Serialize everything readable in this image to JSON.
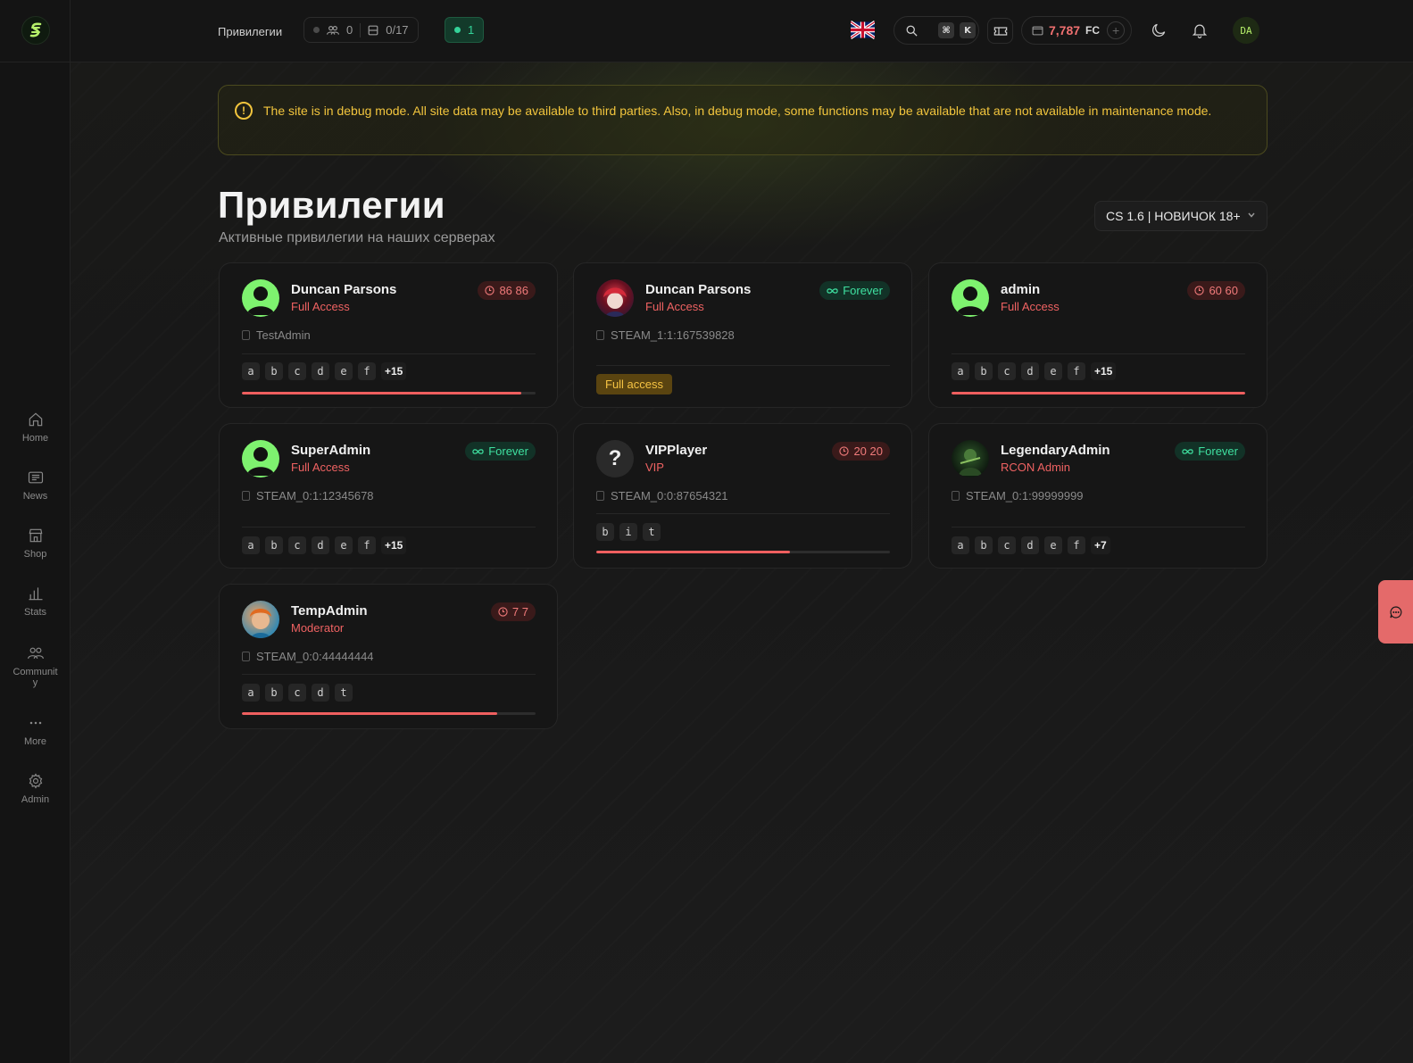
{
  "sidebar": {
    "items": [
      {
        "label": "Home",
        "icon": "home-icon"
      },
      {
        "label": "News",
        "icon": "news-icon"
      },
      {
        "label": "Shop",
        "icon": "shop-icon"
      },
      {
        "label": "Stats",
        "icon": "stats-icon"
      },
      {
        "label": "Community",
        "icon": "community-icon"
      },
      {
        "label": "More",
        "icon": "more-icon"
      },
      {
        "label": "Admin",
        "icon": "gear-icon"
      }
    ]
  },
  "header": {
    "breadcrumb": "Привилегии",
    "players_count": "0",
    "servers_count": "0/17",
    "online_count": "1",
    "search_keys": [
      "⌘",
      "K"
    ],
    "balance_amount": "7,787",
    "balance_currency": "FC",
    "avatar_text": "DA"
  },
  "banner": {
    "text": "The site is in debug mode. All site data may be available to third parties. Also, in debug mode, some functions may be available that are not available in maintenance mode."
  },
  "page": {
    "title": "Привилегии",
    "subtitle": "Активные привилегии на наших серверах",
    "server_select": "CS 1.6 | НОВИЧОК 18+"
  },
  "cards": [
    {
      "name": "Duncan Parsons",
      "role": "Full Access",
      "badge": "86 86",
      "badge_type": "timer",
      "steam": "TestAdmin",
      "flags": [
        "a",
        "b",
        "c",
        "d",
        "e",
        "f"
      ],
      "more": "+15",
      "progress": 0.95
    },
    {
      "name": "Duncan Parsons",
      "role": "Full Access",
      "badge": "Forever",
      "badge_type": "forever",
      "steam": "STEAM_1:1:167539828",
      "full_access": "Full access"
    },
    {
      "name": "admin",
      "role": "Full Access",
      "badge": "60 60",
      "badge_type": "timer",
      "steam": "",
      "flags": [
        "a",
        "b",
        "c",
        "d",
        "e",
        "f"
      ],
      "more": "+15",
      "progress": 1.0
    },
    {
      "name": "SuperAdmin",
      "role": "Full Access",
      "badge": "Forever",
      "badge_type": "forever",
      "steam": "STEAM_0:1:12345678",
      "flags": [
        "a",
        "b",
        "c",
        "d",
        "e",
        "f"
      ],
      "more": "+15"
    },
    {
      "name": "VIPPlayer",
      "role": "VIP",
      "badge": "20 20",
      "badge_type": "timer",
      "steam": "STEAM_0:0:87654321",
      "flags": [
        "b",
        "i",
        "t"
      ],
      "progress": 0.66
    },
    {
      "name": "LegendaryAdmin",
      "role": "RCON Admin",
      "badge": "Forever",
      "badge_type": "forever",
      "steam": "STEAM_0:1:99999999",
      "flags": [
        "a",
        "b",
        "c",
        "d",
        "e",
        "f"
      ],
      "more": "+7"
    },
    {
      "name": "TempAdmin",
      "role": "Moderator",
      "badge": "7 7",
      "badge_type": "timer",
      "steam": "STEAM_0:0:44444444",
      "flags": [
        "a",
        "b",
        "c",
        "d",
        "t"
      ],
      "progress": 0.87
    }
  ],
  "colors": {
    "accent_red": "#ef5f5f",
    "forever_green": "#3fe0a0",
    "warning_yellow": "#f2c53d"
  }
}
